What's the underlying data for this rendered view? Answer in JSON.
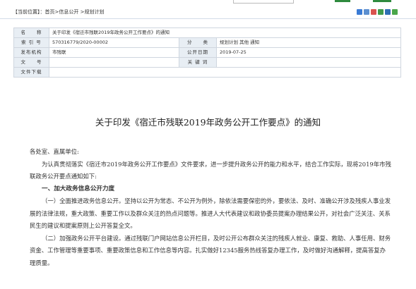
{
  "breadcrumb": {
    "location_label": "【当前位置】",
    "path": "：首页>信息公开 >规划计划"
  },
  "toolbar_icon_colors": [
    "#3a7bd5",
    "#5b8fd0",
    "#d9534f",
    "#3f9b4d",
    "#2f6fb5",
    "#4aa64a"
  ],
  "meta": {
    "name_label": "名　　称",
    "name_value": "关于印发《宿迁市残联2019年政务公开工作要点》的通知",
    "index_label": "索 引 号",
    "index_value": "570316779/2020-00002",
    "category_label": "分　　类",
    "category_value": "规划计划  其他  通知",
    "publisher_label": "发布机构",
    "publisher_value": "市残联",
    "date_label": "公开日期",
    "date_value": "2019-07-25",
    "docno_label": "文　　号",
    "docno_value": "",
    "keywords_label": "关 键 词",
    "keywords_value": "",
    "download_label": "文件下载",
    "download_value": ""
  },
  "article": {
    "title": "关于印发《宿迁市残联2019年政务公开工作要点》的通知",
    "salutation": "各处室、直属单位:",
    "intro": "为认真贯彻落实《宿迁市2019年政务公开工作要点》文件要求，进一步提升政务公开的能力和水平，结合工作实际，现将2019年市残联政务公开要点通知如下:",
    "section1": "一、加大政务信息公开力度",
    "para1": "（一）全面推进政务信息公开。坚持以公开为常态、不公开为例外，除依法需要保密的外，要依法、及时、准确公开涉及残疾人事业发展的法律法规，重大政策、重要工作以及群众关注的热点问题等。推进人大代表建议和政协委员提案办理结果公开，对社会广泛关注、关系民生的建议和提案原则上公开答复全文。",
    "para2": "（二）加强政务公开平台建设。通过残联门户网站信息公开栏目，及时公开公布群众关注的残疾人就业、康复、救助、人事任用、财务资金、工作管理等重要事项、重要政策信息和工作信息等内容。扎实做好12345服务热线答复办理工作，及时做好沟通解释，提高答复办理质量。"
  }
}
